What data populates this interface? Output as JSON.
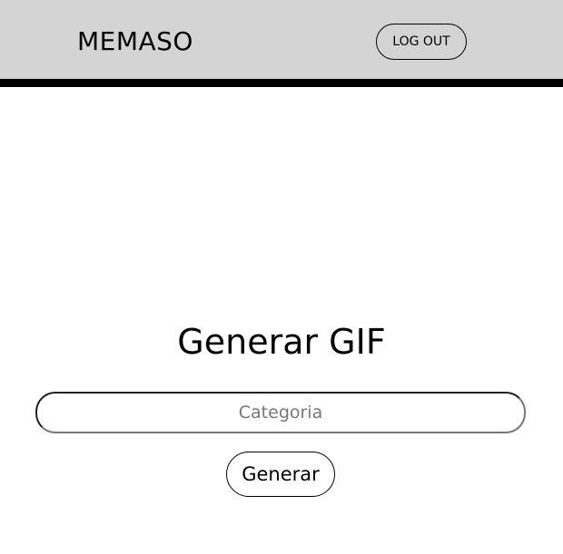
{
  "header": {
    "brand": "MEMASO",
    "logout_label": "LOG OUT",
    "background_color": "#d4d4d4",
    "border_color": "#000000"
  },
  "main": {
    "title": "Generar GIF",
    "category_input": {
      "placeholder": "Categoria",
      "value": ""
    },
    "generate_label": "Generar"
  }
}
